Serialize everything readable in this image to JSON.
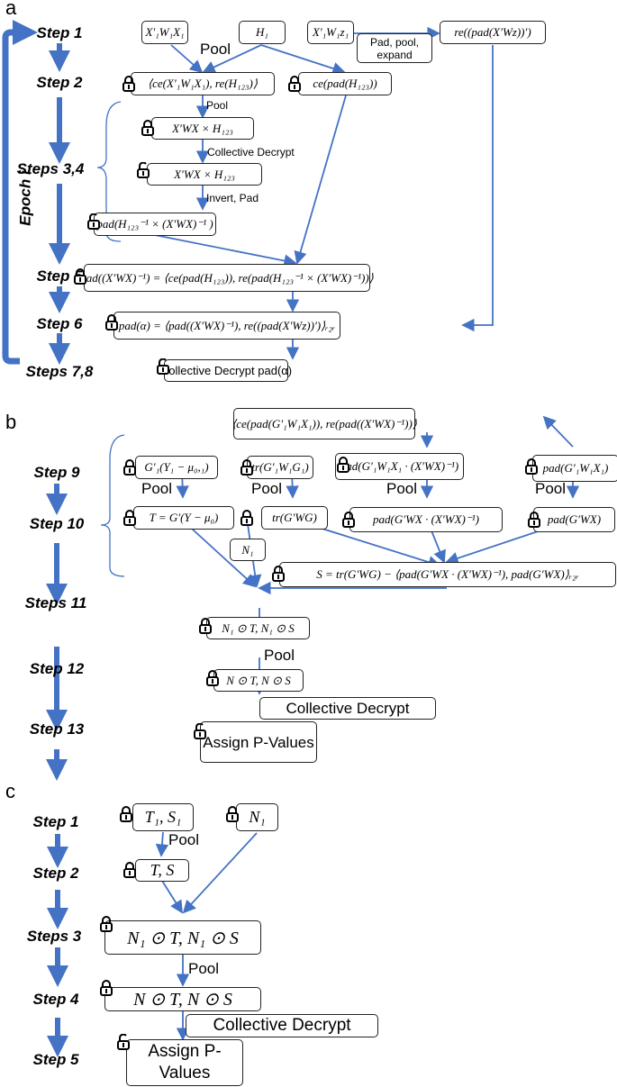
{
  "panels": {
    "a": {
      "label": "a",
      "epoch_label": "Epoch i",
      "steps": [
        "Step 1",
        "Step 2",
        "Steps 3,4",
        "Step 5",
        "Step 6",
        "Steps 7,8"
      ],
      "boxes": {
        "x1w1x1": "X′₁W₁X₁",
        "h1": "H₁",
        "x1w1z1": "X′₁W₁z₁",
        "re_pad": "re((pad(X′Wz))′)",
        "ce_x_re_h": "⟨ce(X′₁W₁X₁), re(H₁₂₃)⟩",
        "ce_pad_h": "ce(pad(H₁₂₃))",
        "xwx_h_locked": "X′WX × H₁₂₃",
        "xwx_h_unlocked": "X′WX × H₁₂₃",
        "pad_inv": "pad(H₁₂₃⁻¹ × (X′WX)⁻¹ )",
        "step5": "pad((X′WX)⁻¹) = ⟨ce(pad(H₁₂₃)), re(pad(H₁₂₃⁻¹ × (X′WX)⁻¹))⟩",
        "step6": "pad(α) = ⟨pad((X′WX)⁻¹), re((pad(X′Wz))′)⟩ᵣ₂ᵣ",
        "step78": "Collective Decrypt pad(α)",
        "pad_pool_expand": "Pad, pool, expand"
      },
      "edge_labels": {
        "pool_top": "Pool",
        "pool_mid": "Pool",
        "collective_decrypt": "Collective Decrypt",
        "invert_pad": "Invert, Pad"
      }
    },
    "b": {
      "label": "b",
      "steps": [
        "Step 9",
        "Step 10",
        "Steps 11",
        "Step 12",
        "Step 13"
      ],
      "boxes": {
        "top": "⟨ce(pad(G′₁W₁X₁)), re(pad((X′WX)⁻¹))⟩",
        "g1y": "G′₁(Y₁ − μ₀,₁)",
        "trg1": "tr(G′₁W₁G₁)",
        "padg1x": "pad(G′₁W₁X₁ · (X′WX)⁻¹)",
        "padg1w": "pad(G′₁W₁X₁)",
        "t": "T = G′(Y − μ₀)",
        "trg": "tr(G′WG)",
        "padgx": "pad(G′WX · (X′WX)⁻¹)",
        "padgwx": "pad(G′WX)",
        "n1": "N₁",
        "s": "S = tr(G′WG) − ⟨pad(G′WX · (X′WX)⁻¹), pad(G′WX)⟩ᵣ₂ᵣ",
        "n1t": "N₁ ⊙ T, N₁ ⊙ S",
        "nt": "N ⊙ T, N ⊙ S",
        "cd": "Collective Decrypt",
        "assign": "Assign P-Values"
      },
      "edge_labels": [
        "Pool",
        "Pool",
        "Pool",
        "Pool",
        "Pool"
      ]
    },
    "c": {
      "label": "c",
      "steps": [
        "Step 1",
        "Step 2",
        "Steps 3",
        "Step 4",
        "Step 5"
      ],
      "boxes": {
        "t1s1": "T₁, S₁",
        "n1": "N₁",
        "ts": "T, S",
        "n1t": "N₁ ⊙ T, N₁ ⊙ S",
        "nt": "N ⊙ T, N ⊙ S",
        "cd": "Collective Decrypt",
        "assign": "Assign P-Values"
      },
      "edge_labels": [
        "Pool",
        "Pool"
      ]
    }
  },
  "colors": {
    "arrow": "#4472c4",
    "border": "#222222"
  }
}
